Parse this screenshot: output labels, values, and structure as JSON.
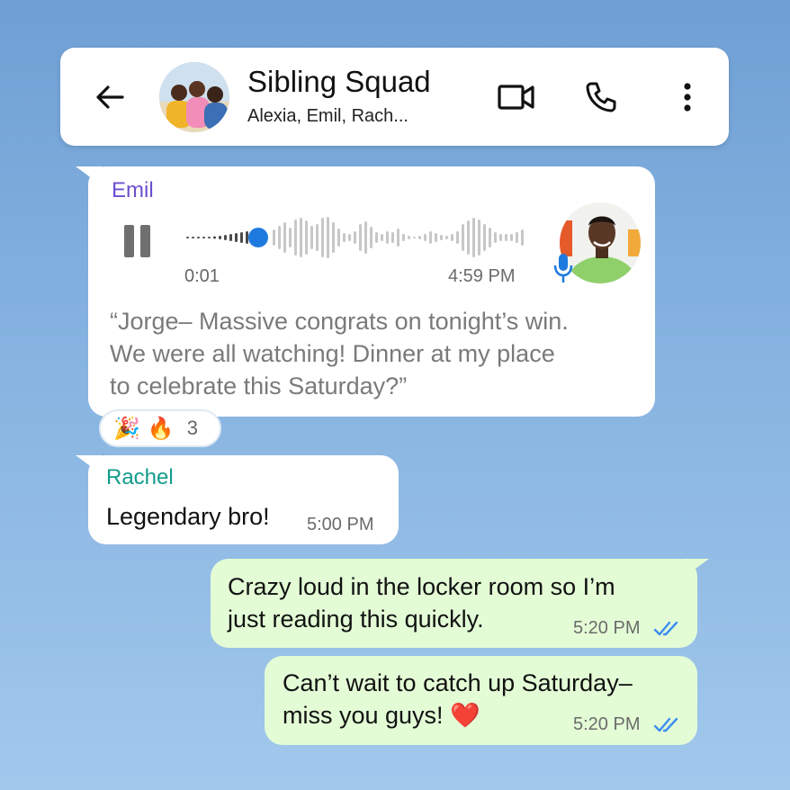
{
  "header": {
    "title": "Sibling Squad",
    "subtitle": "Alexia, Emil, Rach..."
  },
  "colors": {
    "accent": "#0b7cff",
    "emil": "#6c4fd1",
    "rachel": "#129c8c",
    "incoming_bubble": "#ffffff",
    "outgoing_bubble": "#e3fcd6",
    "read_ticks": "#3b8ef0"
  },
  "messages": [
    {
      "sender": "Emil",
      "type": "voice",
      "elapsed": "0:01",
      "time": "4:59 PM",
      "transcript_lines": [
        "“Jorge– Massive congrats on tonight’s win.",
        "We were all watching! Dinner at my place",
        "to celebrate this Saturday?”"
      ],
      "reactions": {
        "emojis": [
          "🎉",
          "🔥"
        ],
        "count": "3"
      }
    },
    {
      "sender": "Rachel",
      "text": "Legendary bro!",
      "time": "5:00 PM"
    },
    {
      "sender": "me",
      "lines": [
        "Crazy loud in the locker room so I’m",
        "just reading this quickly."
      ],
      "time": "5:20 PM"
    },
    {
      "sender": "me",
      "lines": [
        "Can’t wait to catch up Saturday–",
        "miss you guys! ❤️"
      ],
      "time": "5:20 PM"
    }
  ],
  "icons": [
    "back-arrow-icon",
    "group-avatar",
    "video-call-icon",
    "phone-icon",
    "more-vert-icon",
    "pause-icon",
    "mic-icon",
    "double-check-icon"
  ]
}
